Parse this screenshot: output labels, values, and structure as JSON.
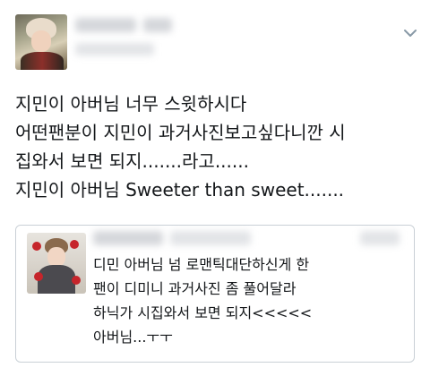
{
  "tweet": {
    "author_avatar_icon": "user-avatar-photo",
    "author_name": "",
    "options_icon": "chevron-down-icon",
    "lines": [
      "지민이 아버님 너무 스윗하시다",
      "어떤팬분이 지민이 과거사진보고싶다니깐 시",
      "집와서 보면 되지.......라고......",
      "지민이 아버님 Sweeter than sweet......."
    ]
  },
  "quoted_tweet": {
    "author_avatar_icon": "quoted-user-avatar-photo",
    "author_name": "",
    "lines": [
      "디민 아버님 넘 로맨틱대단하신게 한",
      "팬이 디미니 과거사진 좀 풀어달라",
      "하닉가 시집와서 보면 되지<<<<<",
      "아버님...ㅜㅜ"
    ]
  },
  "colors": {
    "text": "#14171a",
    "border": "#c9d0d6",
    "chevron": "#8899a6",
    "blur": "#d5d7db"
  }
}
